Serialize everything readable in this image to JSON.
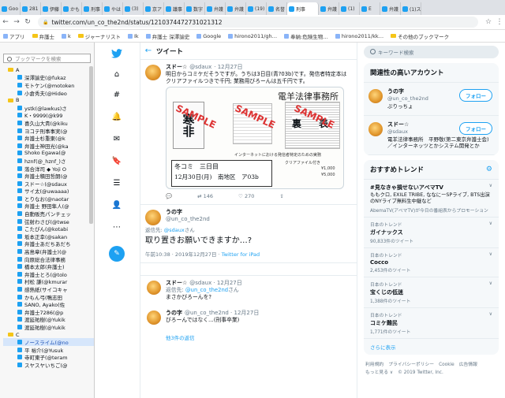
{
  "browser": {
    "tabs": [
      "Goo",
      "281",
      "伊藤",
      "かも",
      "刑事",
      "やは",
      "(3)",
      "京ア",
      "議事",
      "数字",
      "弁護",
      "弁護",
      "(19)",
      "名誉",
      "刑事",
      "弁護",
      "(1)",
      "E",
      "弁護",
      "(1)ス"
    ],
    "url": "twitter.com/un_co_the2nd/status/1210374472731021312"
  },
  "bookmarks_bar": [
    "アプリ",
    "弁護士",
    "k",
    "ジャーナリスト",
    "Ik",
    "弁護士 深澤諭史",
    "Google",
    "hirono2011/gh…",
    "奉納:危険生物…",
    "hirono2011/kk…",
    "その他のブックマーク"
  ],
  "sidebar": {
    "search_placeholder": "ブックマークを検索",
    "items": [
      {
        "t": "A",
        "folder": true
      },
      {
        "t": "深澤諭史(@fukaz"
      },
      {
        "t": "モトケン(@motoken"
      },
      {
        "t": "小倉秀夫(@Hideo"
      },
      {
        "t": "B",
        "folder": true
      },
      {
        "t": "ystk(@lawkus)さ"
      },
      {
        "t": "K・9999(@k99"
      },
      {
        "t": "喜久山大貴(@kiku"
      },
      {
        "t": "ヨコテ刑事事実(@"
      },
      {
        "t": "弁護士杉重東(@k"
      },
      {
        "t": "弁護士神田光(@ka"
      },
      {
        "t": "Shoko Egawa(@"
      },
      {
        "t": "hznf(@_hznf_)さ"
      },
      {
        "t": "落合洋司 ◆ Yoji O"
      },
      {
        "t": "弁護士積田哲朗(@"
      },
      {
        "t": "スドー☆(@sdaux"
      },
      {
        "t": "サイ太(@uwaaaa)"
      },
      {
        "t": "とりなお(@naotar"
      },
      {
        "t": "弁護士 野田隼人(@"
      },
      {
        "t": "自動販売パンチェッ"
      },
      {
        "t": "弦射わさび(@twse"
      },
      {
        "t": "こたぴん(@kotabi"
      },
      {
        "t": "坂本正幸(@sakan"
      },
      {
        "t": "弁護士あだちあだち"
      },
      {
        "t": "高島章(弁護士)(@"
      },
      {
        "t": "向原総合法律事務"
      },
      {
        "t": "橋本太郎(弁護士)"
      },
      {
        "t": "弁護士とろ(@tolo"
      },
      {
        "t": "村松 謙(@kmurar"
      },
      {
        "t": "感熱紙(サイコキャ"
      },
      {
        "t": "かもん弓(鴨志田"
      },
      {
        "t": "SANO, Ayako(佐"
      },
      {
        "t": "弁護士7286(@p"
      },
      {
        "t": "渡延祐樹(@Yukik"
      },
      {
        "t": "渡延祐樹(@Yukik"
      },
      {
        "t": "C",
        "folder": true
      },
      {
        "t": "ノースライム(@no",
        "hl": true
      },
      {
        "t": "平 裕介(@Yusuk"
      },
      {
        "t": "寺町東子(@teram"
      },
      {
        "t": "スヤスヤいちご(@"
      }
    ]
  },
  "main": {
    "header_title": "ツイート",
    "tweet1": {
      "name": "スドー☆",
      "handle": "@sdaux",
      "date": "· 12月27日",
      "text": "明日からコミケだそうですが。うちは3日目(青?03b)です。発信者特定本はクリアファイルつきで千円; 業務用びろーんは五千円です。",
      "media": {
        "title": "電羊法律事務所",
        "sample": "SAMPLE",
        "big_char": "寒非",
        "center_caption": "インターネットにおける発信者特定のための実務",
        "ura": "裏",
        "hyo": "表",
        "line1": "冬コミ　三日目",
        "line2": "12月30日(月)　南地区　ア03b",
        "small_note": "クリアファイル付き",
        "price1": "¥1,000",
        "price2": "¥5,000"
      },
      "replies": "",
      "retweets": "146",
      "likes": "270"
    },
    "tweet2": {
      "name": "うの字",
      "handle": "@un_co_the2nd",
      "reply_prefix": "返信先:",
      "reply_to": "@sdaux",
      "reply_suffix": "さん",
      "text": "取り置きお願いできますか…?",
      "time": "午前10:38 · 2019年12月27日 ·",
      "via": "Twitter for iPad"
    },
    "reply1": {
      "name": "スドー☆",
      "handle": "@sdaux · 12月27日",
      "reply_prefix": "返信先:",
      "reply_to": "@un_co_the2nd",
      "reply_suffix": "さん",
      "text": "まさかびろーんを?"
    },
    "reply2": {
      "name": "うの字",
      "handle": "@un_co_the2nd · 12月27日",
      "text": "びろーんではなく…(刑事卒業)"
    },
    "more_replies": "他3件の返信"
  },
  "right": {
    "search_placeholder": "キーワード検索",
    "related_title": "関連性の高いアカウント",
    "accounts": [
      {
        "name": "うの字",
        "handle": "@un_co_the2nd",
        "bio": "ぷりっちょ",
        "follow": "フォロー"
      },
      {
        "name": "スドー☆",
        "handle": "@sdaux",
        "bio": "電羊法律事務所　平野敬(第二東京弁護士会)／インターネッツとかシステム開発とか",
        "follow": "フォロー"
      }
    ],
    "trends_title": "おすすめトレンド",
    "trends": [
      {
        "ctx": "",
        "name": "#見なきゃ損せないアベマTV",
        "desc": "ももクロ, EXILE TRIBE, ななにーSPライブ, BTS出演のNYライブ無料生中継など",
        "count": "AbemaTV(アベマTV)が今日の番組表からプロモーション"
      },
      {
        "ctx": "日本のトレンド",
        "name": "ガイナックス",
        "desc": "",
        "count": "90,833件のツイート"
      },
      {
        "ctx": "日本のトレンド",
        "name": "Cocco",
        "desc": "",
        "count": "2,453件のツイート"
      },
      {
        "ctx": "日本のトレンド",
        "name": "宝くじの低迷",
        "desc": "",
        "count": "1,388件のツイート"
      },
      {
        "ctx": "日本のトレンド",
        "name": "コミケ難民",
        "desc": "",
        "count": "1,771件のツイート"
      }
    ],
    "show_more": "さらに表示",
    "footer": [
      "利用規約",
      "プライバシーポリシー",
      "Cookie",
      "広告情報",
      "もっと見る ∨",
      "© 2019 Twitter, Inc."
    ]
  }
}
